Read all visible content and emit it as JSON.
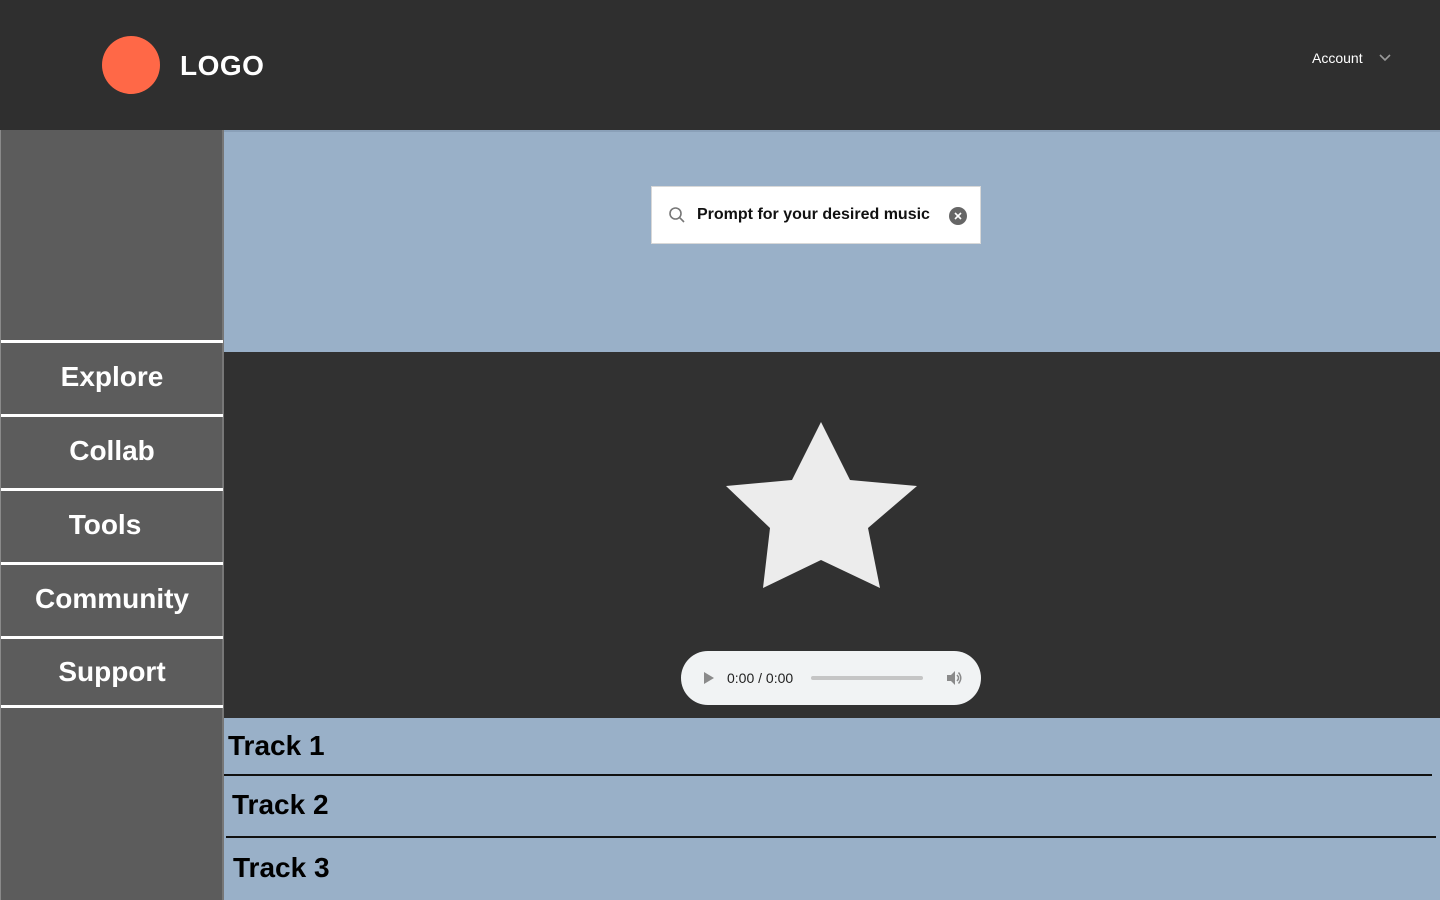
{
  "header": {
    "logo": "LOGO",
    "account_label": "Account"
  },
  "sidebar": {
    "items": [
      {
        "label": "Explore"
      },
      {
        "label": "Collab"
      },
      {
        "label": "Tools"
      },
      {
        "label": "Community"
      },
      {
        "label": "Support"
      }
    ]
  },
  "search": {
    "value": "Prompt for your desired music"
  },
  "player": {
    "time": "0:00 / 0:00",
    "progress": 0
  },
  "tracks": [
    {
      "label": "Track 1"
    },
    {
      "label": "Track 2"
    },
    {
      "label": "Track 3"
    }
  ],
  "colors": {
    "accent": "#ff6847",
    "header_bg": "#2f2f2f",
    "sidebar_bg": "#5c5c5c",
    "panel_bg": "#99b0c8",
    "player_bg": "#313131",
    "star_fill": "#ececec"
  },
  "icons": {
    "logo": "circle-logo-icon",
    "account": "chevron-down-icon",
    "search": "search-icon",
    "clear": "clear-icon",
    "hero": "star-icon",
    "play": "play-icon",
    "volume": "volume-icon"
  }
}
